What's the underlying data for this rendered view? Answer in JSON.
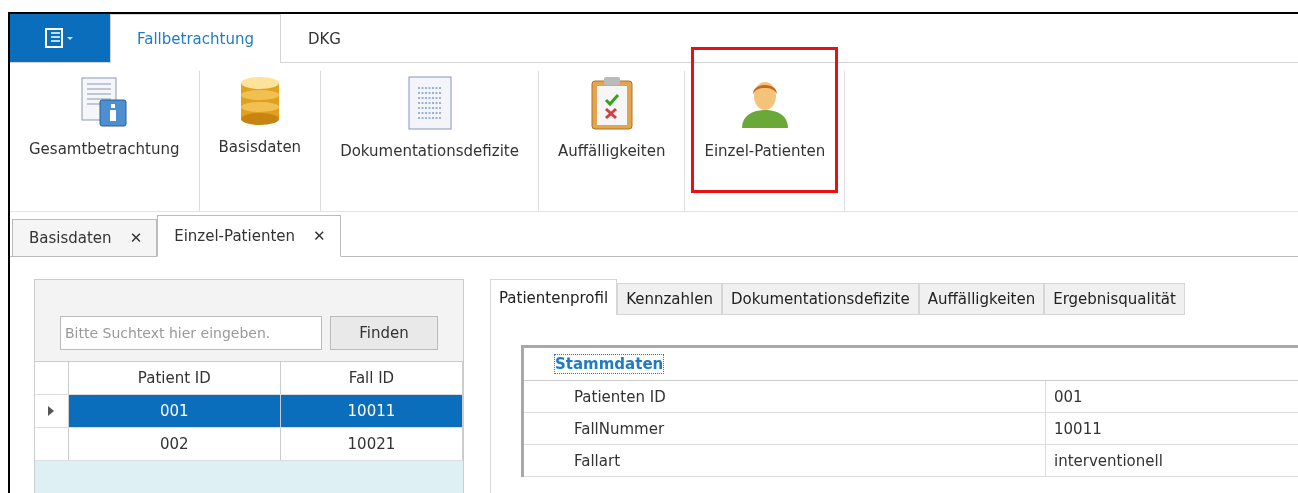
{
  "ribbon_tabs": [
    {
      "label": "Fallbetrachtung",
      "selected": true
    },
    {
      "label": "DKG",
      "selected": false
    }
  ],
  "ribbon_items": [
    {
      "kind": "document-info",
      "label": "Gesamtbetrachtung",
      "highlighted": false
    },
    {
      "kind": "database",
      "label": "Basisdaten",
      "highlighted": false
    },
    {
      "kind": "sheet",
      "label": "Dokumentationsdefizite",
      "highlighted": false
    },
    {
      "kind": "clipboard",
      "label": "Auffälligkeiten",
      "highlighted": false
    },
    {
      "kind": "person",
      "label": "Einzel-Patienten",
      "highlighted": true
    }
  ],
  "document_tabs": [
    {
      "label": "Basisdaten",
      "selected": false,
      "close": "✕"
    },
    {
      "label": "Einzel-Patienten",
      "selected": true,
      "close": "✕"
    }
  ],
  "search": {
    "placeholder": "Bitte Suchtext hier eingeben.",
    "button": "Finden"
  },
  "patient_table": {
    "columns": [
      "Patient ID",
      "Fall ID"
    ],
    "rows": [
      {
        "cells": [
          "001",
          "10011"
        ],
        "selected": true
      },
      {
        "cells": [
          "002",
          "10021"
        ],
        "selected": false
      }
    ]
  },
  "detail_tabs": [
    {
      "label": "Patientenprofil",
      "selected": true
    },
    {
      "label": "Kennzahlen",
      "selected": false
    },
    {
      "label": "Dokumentationsdefizite",
      "selected": false
    },
    {
      "label": "Auffälligkeiten",
      "selected": false
    },
    {
      "label": "Ergebnisqualität",
      "selected": false
    }
  ],
  "profile": {
    "section": "Stammdaten",
    "rows": [
      {
        "label": "Patienten ID",
        "value": "001"
      },
      {
        "label": "FallNummer",
        "value": "10011"
      },
      {
        "label": "Fallart",
        "value": "interventionell"
      }
    ]
  }
}
